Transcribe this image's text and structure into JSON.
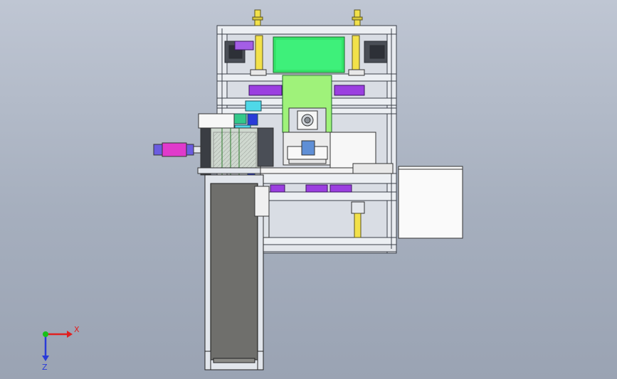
{
  "view": {
    "axis_triad": {
      "x_label": "X",
      "z_label": "Z",
      "x_color": "#e02020",
      "z_color": "#2a3bd8",
      "origin_color": "#18c018"
    }
  },
  "palette": {
    "frame": "#e2e6ec",
    "frame_line": "#3a3f48",
    "green": "#33e46a",
    "light_green": "#a8f27a",
    "yellow": "#f2e14a",
    "purple": "#9b3fe0",
    "magenta": "#e03acb",
    "cyan": "#4fd8e8",
    "blue": "#2a3bd8",
    "conveyor": "#6f6f6c",
    "white_box": "#f7f7f7",
    "orange": "#e0a05a"
  }
}
